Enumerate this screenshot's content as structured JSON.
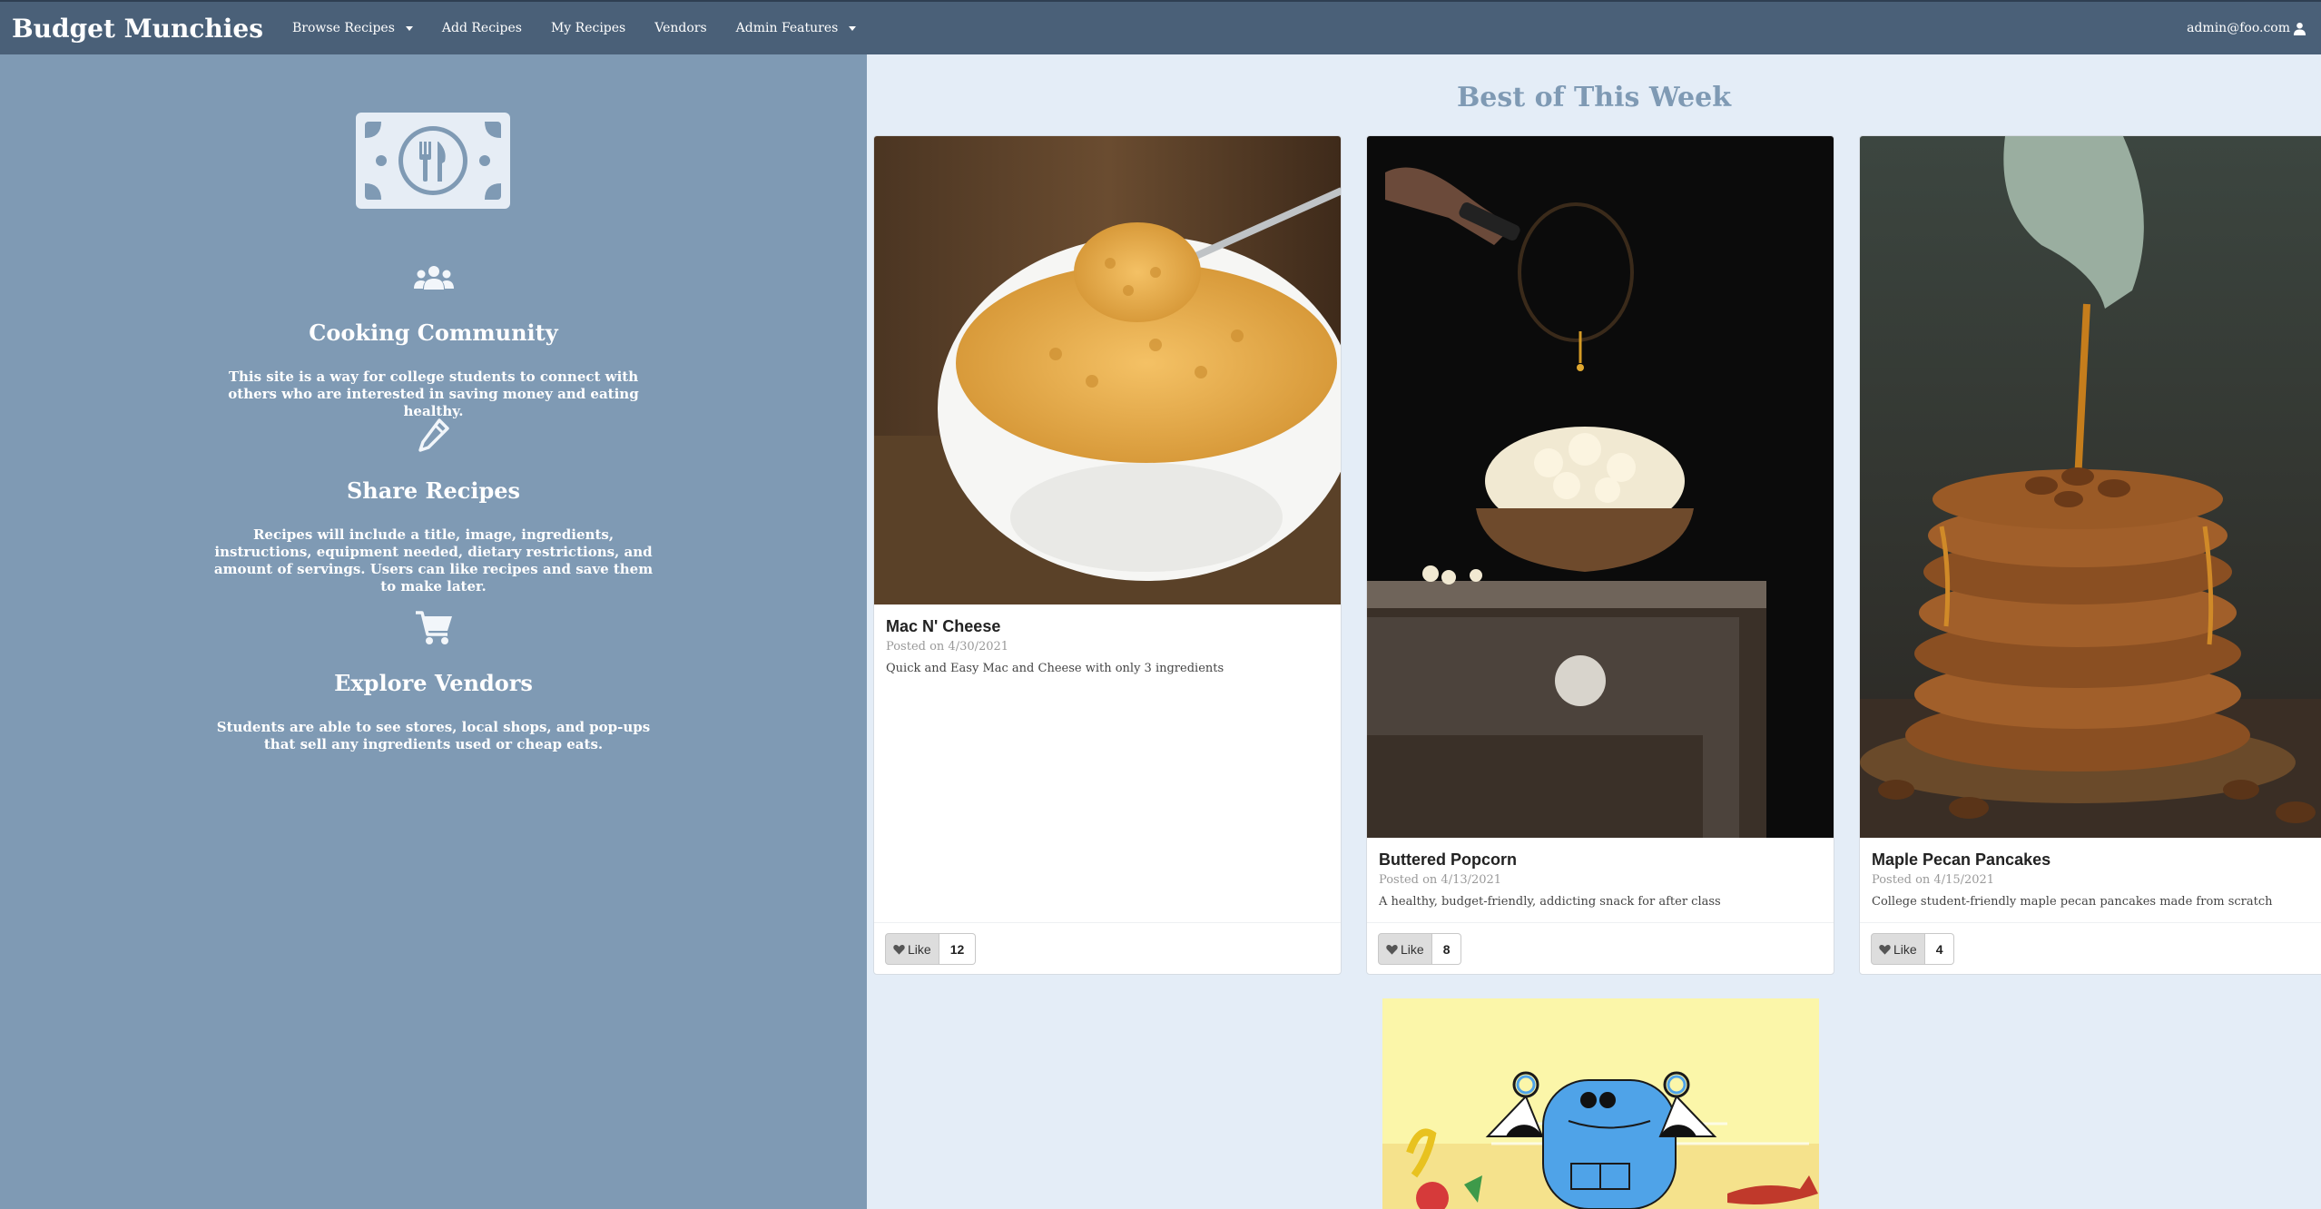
{
  "navbar": {
    "brand": "Budget Munchies",
    "items": [
      {
        "label": "Browse Recipes",
        "dropdown": true
      },
      {
        "label": "Add Recipes",
        "dropdown": false
      },
      {
        "label": "My Recipes",
        "dropdown": false
      },
      {
        "label": "Vendors",
        "dropdown": false
      },
      {
        "label": "Admin Features",
        "dropdown": true
      }
    ],
    "user": "admin@foo.com",
    "user_icon": "user-icon"
  },
  "sidebar": {
    "logo_icon": "money-utensils-icon",
    "features": [
      {
        "icon": "users-icon",
        "title": "Cooking Community",
        "text": "This site is a way for college students to connect with others who are interested in saving money and eating healthy."
      },
      {
        "icon": "pencil-icon",
        "title": "Share Recipes",
        "text": "Recipes will include a title, image, ingredients, instructions, equipment needed, dietary restrictions, and amount of servings. Users can like recipes and save them to make later."
      },
      {
        "icon": "cart-icon",
        "title": "Explore Vendors",
        "text": "Students are able to see stores, local shops, and pop-ups that sell any ingredients used or cheap eats."
      }
    ]
  },
  "main": {
    "section_title": "Best of This Week",
    "like_label": "Like",
    "cards": [
      {
        "title": "Mac N' Cheese",
        "date": "Posted on 4/30/2021",
        "description": "Quick and Easy Mac and Cheese with only 3 ingredients",
        "likes": "12"
      },
      {
        "title": "Buttered Popcorn",
        "date": "Posted on 4/13/2021",
        "description": "A healthy, budget-friendly, addicting snack for after class",
        "likes": "8"
      },
      {
        "title": "Maple Pecan Pancakes",
        "date": "Posted on 4/15/2021",
        "description": "College student-friendly maple pecan pancakes made from scratch",
        "likes": "4"
      }
    ]
  },
  "colors": {
    "navbar": "#4a6078",
    "sidebar": "#7f9ab4",
    "background": "#e4edf7",
    "accent": "#7f9ab4"
  }
}
